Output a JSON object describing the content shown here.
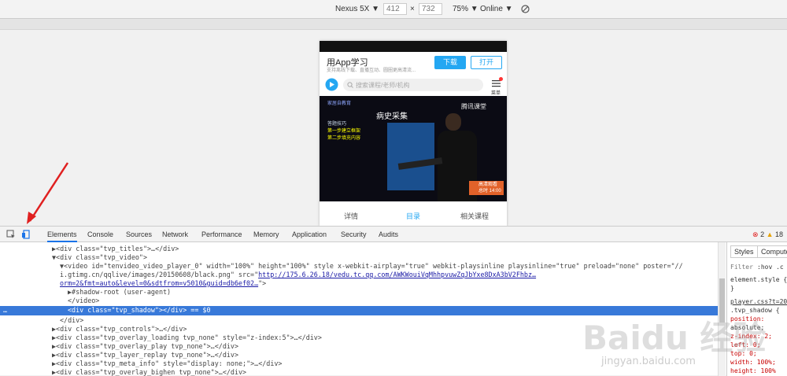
{
  "device_toolbar": {
    "device": "Nexus 5X",
    "width": "412",
    "times": "×",
    "height": "732",
    "zoom": "75%",
    "network": "Online"
  },
  "mobile_page": {
    "app_title": "用App学习",
    "app_subtitle": "支持离线下载、直播互动、圆圈更高清流...",
    "download_label": "下载",
    "open_label": "打开",
    "search_placeholder": "搜索课程/老师/机构",
    "menu_label": "菜单",
    "video": {
      "brand": "家居自教育",
      "tencent": "腾讯课堂",
      "title": "病史采集",
      "side_heading": "答题技巧",
      "side_step1": "第一步建立框架",
      "side_step2": "第二步填充内容",
      "badge_line1": "高清观看",
      "badge_line2": "总时 14:00"
    },
    "tabs": [
      "详情",
      "目录",
      "相关课程"
    ],
    "active_tab": 1
  },
  "devtools": {
    "tabs": [
      "Elements",
      "Console",
      "Sources",
      "Network",
      "Performance",
      "Memory",
      "Application",
      "Security",
      "Audits"
    ],
    "error_count": "2",
    "warning_count": "18",
    "styles_tabs": [
      "Styles",
      "Compute"
    ],
    "styles_lines": [
      "Filter",
      ":hov  .c",
      "element.style {",
      "}",
      "player.css?t=20",
      ".tvp_shadow {",
      "position:",
      "  absolute;",
      "z-index: 2;",
      "left: 0;",
      "top: 0;",
      "width: 100%;",
      "height: 100%"
    ],
    "code": {
      "l1": "▶<div class=\"tvp_titles\">…</div>",
      "l2": "▼<div class=\"tvp_video\">",
      "l3": "▼<video id=\"tenvideo_video_player_0\" width=\"100%\" height=\"100%\" style x-webkit-airplay=\"true\" webkit-playsinline playsinline=\"true\" preload=\"none\" poster=\"//",
      "l4": "i.gtimg.cn/qqlive/images/20150608/black.png\" src=\"",
      "l4_link": "http://175.6.26.18/vedu.tc.qq.com/AWKWouiVqMhhpvuwZqJbYxe8DxA3bV2Fhbz…",
      "l5_link": "orm=2&fmt=auto&level=0&sdtfrom=v5010&guid=db6ef02…",
      "l5_end": "\">",
      "l6": "▶#shadow-root (user-agent)",
      "l7": "</video>",
      "l8": "<div class=\"tvp_shadow\"></div> == $0",
      "l8_dots": "…",
      "l9": "</div>",
      "l10": "▶<div class=\"tvp_controls\">…</div>",
      "l11": "▶<div class=\"tvp_overlay_loading tvp_none\" style=\"z-index:5\">…</div>",
      "l12": "▶<div class=\"tvp_overlay_play tvp_none\">…</div>",
      "l13": "▶<div class=\"tvp_layer_replay tvp_none\">…</div>",
      "l14": "▶<div class=\"tvp_meta_info\" style=\"display: none;\">…</div>",
      "l15": "▶<div class=\"tvp_overlay_bighen tvp_none\">…</div>"
    }
  },
  "watermark": {
    "main": "Baidu 经验",
    "sub": "jingyan.baidu.com"
  }
}
